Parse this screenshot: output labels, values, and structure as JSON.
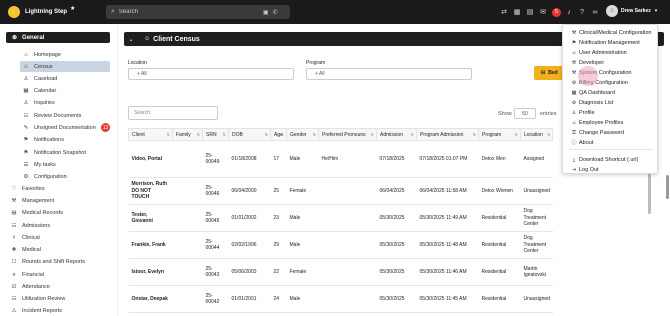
{
  "app": {
    "name": "Lightning Step",
    "logo_letter": "⚡"
  },
  "topbar": {
    "search_placeholder": "Search",
    "notification_count": "5",
    "user_name": "Drew Sarkez"
  },
  "sidebar": {
    "group_label": "General",
    "items": [
      {
        "label": "Homepage",
        "icon": "home-icon",
        "glyph": "⌂"
      },
      {
        "label": "Census",
        "icon": "people-icon",
        "glyph": "☺"
      },
      {
        "label": "Caseload",
        "icon": "person-icon",
        "glyph": "♙"
      },
      {
        "label": "Calendar",
        "icon": "calendar-icon",
        "glyph": "▦"
      },
      {
        "label": "Inquiries",
        "icon": "user-plus-icon",
        "glyph": "♙"
      },
      {
        "label": "Review Documents",
        "icon": "document-icon",
        "glyph": "☷"
      },
      {
        "label": "Unsigned Documentation",
        "icon": "pen-icon",
        "glyph": "✎",
        "badge": "13"
      },
      {
        "label": "Notifications",
        "icon": "bell-icon",
        "glyph": "⚑"
      },
      {
        "label": "Notification Snapshot",
        "icon": "snapshot-icon",
        "glyph": "⚑"
      },
      {
        "label": "My tasks",
        "icon": "tasks-icon",
        "glyph": "☰"
      },
      {
        "label": "Configuration",
        "icon": "gear-icon",
        "glyph": "⚙"
      }
    ],
    "sections": [
      {
        "label": "Favorites",
        "icon": "heart-icon",
        "glyph": "♡"
      },
      {
        "label": "Management",
        "icon": "management-icon",
        "glyph": "⚒"
      },
      {
        "label": "Medical Records",
        "icon": "folder-icon",
        "glyph": "▤"
      },
      {
        "label": "Admissions",
        "icon": "admissions-icon",
        "glyph": "☷"
      },
      {
        "label": "Clinical",
        "icon": "stethoscope-icon",
        "glyph": "⚕"
      },
      {
        "label": "Medical",
        "icon": "medical-icon",
        "glyph": "✚"
      },
      {
        "label": "Rounds and Shift Reports",
        "icon": "clipboard-icon",
        "glyph": "☐"
      },
      {
        "label": "Financial",
        "icon": "dollar-icon",
        "glyph": "¤"
      },
      {
        "label": "Attendance",
        "icon": "attendance-icon",
        "glyph": "☑"
      },
      {
        "label": "Utilization Review",
        "icon": "review-icon",
        "glyph": "☷"
      },
      {
        "label": "Incident Reports",
        "icon": "alert-icon",
        "glyph": "⚠"
      }
    ]
  },
  "panel": {
    "title": "Client Census",
    "location_label": "Location",
    "location_value": "All",
    "program_label": "Program",
    "program_value": "All",
    "bed_button_label": "Bed",
    "table_search_placeholder": "Search:",
    "show_label": "Show",
    "show_value": "50",
    "entries_label": "entries"
  },
  "table": {
    "columns": [
      "Client",
      "Family",
      "SRN",
      "DOB",
      "Age",
      "Gender",
      "Preferred Pronouns",
      "Admission",
      "Program Admission",
      "Program",
      "Location"
    ],
    "rows": [
      {
        "client": "Video, Portal",
        "family": "",
        "srn": "25-00049",
        "dob": "01/18/2008",
        "age": "17",
        "gender": "Male",
        "pronouns": "He/Him",
        "admission": "07/18/2025",
        "program_admission": "07/18/2025 01:07 PM",
        "program": "Detox Men",
        "location": "Assigned"
      },
      {
        "client": "Morrison, Ruth DO NOT TOUCH",
        "family": "",
        "srn": "25-00046",
        "dob": "06/04/2000",
        "age": "25",
        "gender": "Female",
        "pronouns": "",
        "admission": "06/04/2025",
        "program_admission": "06/04/2025 11:58 AM",
        "program": "Detox Women",
        "location": "Unassigned"
      },
      {
        "client": "Tester, Giovanni",
        "family": "",
        "srn": "25-00045",
        "dob": "01/01/2002",
        "age": "23",
        "gender": "Male",
        "pronouns": "",
        "admission": "05/30/2025",
        "program_admission": "05/30/2025 11:49 AM",
        "program": "Residential",
        "location": "Dog Treatment Center"
      },
      {
        "client": "Frankie, Frank",
        "family": "",
        "srn": "25-00044",
        "dob": "02/02/1996",
        "age": "29",
        "gender": "Male",
        "pronouns": "",
        "admission": "05/30/2025",
        "program_admission": "05/30/2025 11:48 AM",
        "program": "Residential",
        "location": "Dog Treatment Center"
      },
      {
        "client": "Istoor, Evelyn",
        "family": "",
        "srn": "25-00043",
        "dob": "05/06/2003",
        "age": "22",
        "gender": "Female",
        "pronouns": "",
        "admission": "05/30/2025",
        "program_admission": "05/30/2025 11:46 AM",
        "program": "Residential",
        "location": "Martin Ignatovski"
      },
      {
        "client": "Onstar, Deepak",
        "family": "",
        "srn": "25-00042",
        "dob": "01/01/2001",
        "age": "24",
        "gender": "Male",
        "pronouns": "",
        "admission": "05/30/2025",
        "program_admission": "05/30/2025 11:45 AM",
        "program": "Residential",
        "location": "Unassigned"
      }
    ]
  },
  "user_menu": {
    "items": [
      {
        "label": "Clinical/Medical Configuration",
        "icon": "wrench-icon",
        "glyph": "⚒"
      },
      {
        "label": "Notification Management",
        "icon": "bell-icon",
        "glyph": "⚑"
      },
      {
        "label": "User Administration",
        "icon": "users-icon",
        "glyph": "☺"
      },
      {
        "label": "Developer",
        "icon": "wrench-icon",
        "glyph": "⚒"
      },
      {
        "label": "System Configuration",
        "icon": "wrench-icon",
        "glyph": "⚒"
      },
      {
        "label": "Billing Configuration",
        "icon": "gears-icon",
        "glyph": "⚙"
      },
      {
        "label": "QA Dashboard",
        "icon": "dashboard-icon",
        "glyph": "▦"
      },
      {
        "label": "Diagnosis List",
        "icon": "gear-icon",
        "glyph": "⚙"
      },
      {
        "label": "Profile",
        "icon": "user-icon",
        "glyph": "♙"
      },
      {
        "label": "Employee Profiles",
        "icon": "users-icon",
        "glyph": "☺"
      },
      {
        "label": "Change Password",
        "icon": "key-icon",
        "glyph": "⚿"
      },
      {
        "label": "About",
        "icon": "info-icon",
        "glyph": "ⓘ"
      },
      {
        "label": "Download Shortcut (.url)",
        "icon": "download-icon",
        "glyph": "⤓"
      },
      {
        "label": "Log Out",
        "icon": "logout-icon",
        "glyph": "⇥"
      }
    ]
  },
  "colors": {
    "topbar": "#1a1a1a",
    "accent_yellow": "#f2b01e",
    "badge_red": "#e53935",
    "active_nav": "#c9d4e3"
  }
}
